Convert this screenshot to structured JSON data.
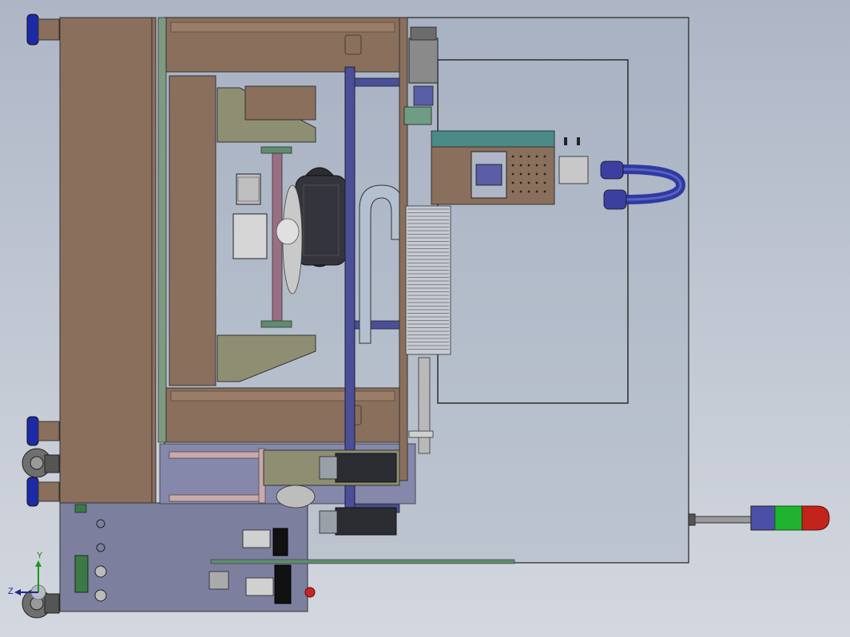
{
  "view": {
    "background_top": "#aeb6c6",
    "background_bottom": "#d3d7df"
  },
  "triad": {
    "x_label": "",
    "y_label": "Y",
    "z_label": "Z"
  },
  "colors": {
    "frame_brown": "#8a6f5c",
    "panel_purple": "#7d7f9e",
    "rail_blue": "#4a4f96",
    "guard_glass": "#9aa9b9",
    "motor_dark": "#2c2c33",
    "bracket_olive": "#8e8f72",
    "teal_block": "#4b8a86",
    "tower_green": "#1fb32f",
    "tower_red": "#c2241c",
    "tower_blue": "#4b4fa8",
    "cable_blue": "#2f3aa0",
    "knob_blue": "#1d2aa6"
  }
}
